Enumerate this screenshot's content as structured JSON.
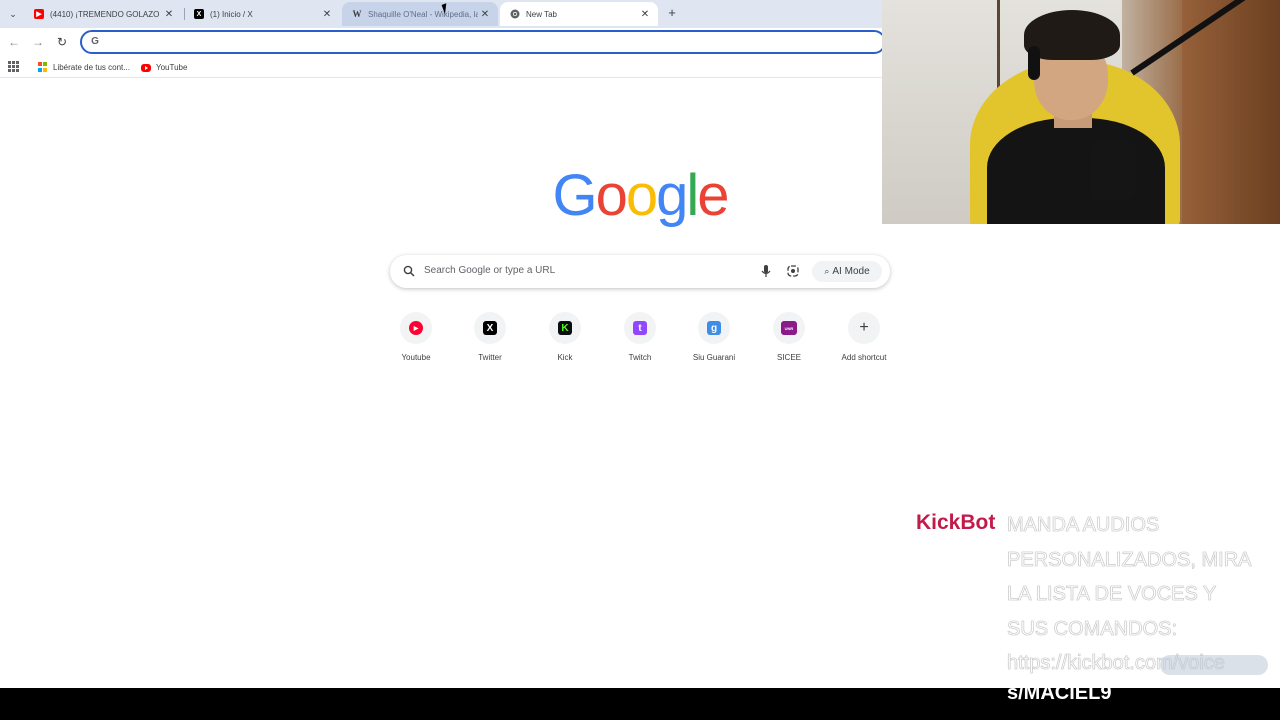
{
  "browser": {
    "tabs": [
      {
        "title": "(4410) ¡TREMENDO GOLAZO D",
        "favicon": "youtube-icon",
        "state": "normal"
      },
      {
        "title": "(1) Inicio / X",
        "favicon": "x-icon",
        "state": "normal"
      },
      {
        "title": "Shaquille O'Neal - Wikipedia, la",
        "favicon": "wikipedia-icon",
        "state": "hover"
      },
      {
        "title": "New Tab",
        "favicon": "chrome-icon",
        "state": "active"
      }
    ],
    "new_tab_symbol": "+",
    "close_symbol": "✕",
    "omnibox": {
      "value": "",
      "icon": "G"
    }
  },
  "bookmarks": [
    {
      "label": "Libérate de tus cont...",
      "icon": "microsoft-icon"
    },
    {
      "label": "YouTube",
      "icon": "youtube-icon"
    }
  ],
  "ntp": {
    "logo": [
      "G",
      "o",
      "o",
      "g",
      "l",
      "e"
    ],
    "search": {
      "placeholder": "Search Google or type a URL",
      "ai_mode_label": "AI Mode"
    },
    "shortcuts": [
      {
        "label": "Youtube",
        "icon": "youtube-icon",
        "color": "#ff0033",
        "glyph": "▶"
      },
      {
        "label": "Twitter",
        "icon": "x-icon",
        "color": "#000000",
        "glyph": "X"
      },
      {
        "label": "Kick",
        "icon": "kick-icon",
        "color": "#53fc18",
        "glyph": "K"
      },
      {
        "label": "Twitch",
        "icon": "twitch-icon",
        "color": "#9146ff",
        "glyph": "t"
      },
      {
        "label": "Siu Guarani",
        "icon": "siu-guarani-icon",
        "color": "#3d8ee8",
        "glyph": "g"
      },
      {
        "label": "SICEE",
        "icon": "sicee-icon",
        "color": "#8b1a8b",
        "glyph": "UNR"
      },
      {
        "label": "Add shortcut",
        "icon": "plus-icon",
        "color": "#3c4043",
        "glyph": "+"
      }
    ]
  },
  "overlay": {
    "bot_name": "KickBot",
    "message_lines": [
      "MANDA AUDIOS",
      "PERSONALIZADOS, MIRA",
      "LA LISTA DE VOCES Y",
      "SUS COMANDOS:",
      "https://kickbot.com/voice"
    ],
    "message_last": "s/MACIEL9"
  },
  "colors": {
    "google_blue": "#4285f4",
    "google_red": "#ea4335",
    "google_yellow": "#fbbc05",
    "google_green": "#34a853",
    "kickbot_name": "#c21a4a",
    "omnibox_focus": "#2a5fcb"
  }
}
